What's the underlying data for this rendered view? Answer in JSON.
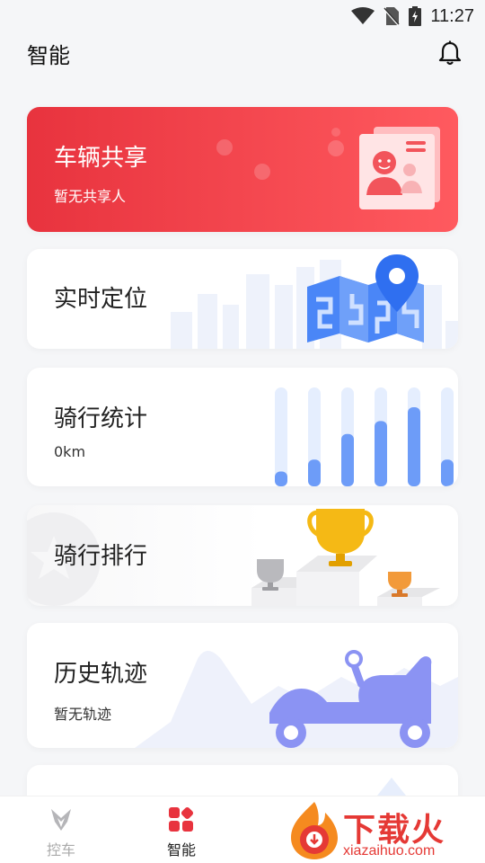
{
  "status_bar": {
    "time": "11:27"
  },
  "header": {
    "title": "智能"
  },
  "cards": {
    "share": {
      "title": "车辆共享",
      "subtitle": "暂无共享人"
    },
    "location": {
      "title": "实时定位"
    },
    "stats": {
      "title": "骑行统计",
      "subtitle": "0km",
      "bar_levels": [
        0.15,
        0.27,
        0.53,
        0.66,
        0.8,
        0.27
      ]
    },
    "ranking": {
      "title": "骑行排行"
    },
    "track": {
      "title": "历史轨迹",
      "subtitle": "暂无轨迹"
    }
  },
  "tabbar": {
    "tabs": [
      {
        "label": "控车",
        "active": false
      },
      {
        "label": "智能",
        "active": true
      }
    ]
  },
  "watermark": {
    "brand": "下载火",
    "url": "xiazaihuo.com"
  },
  "colors": {
    "accent_red": "#e8333e",
    "blue": "#4a86f7",
    "bar_blue": "#6d9cf8",
    "bar_track": "#e5eefe"
  }
}
